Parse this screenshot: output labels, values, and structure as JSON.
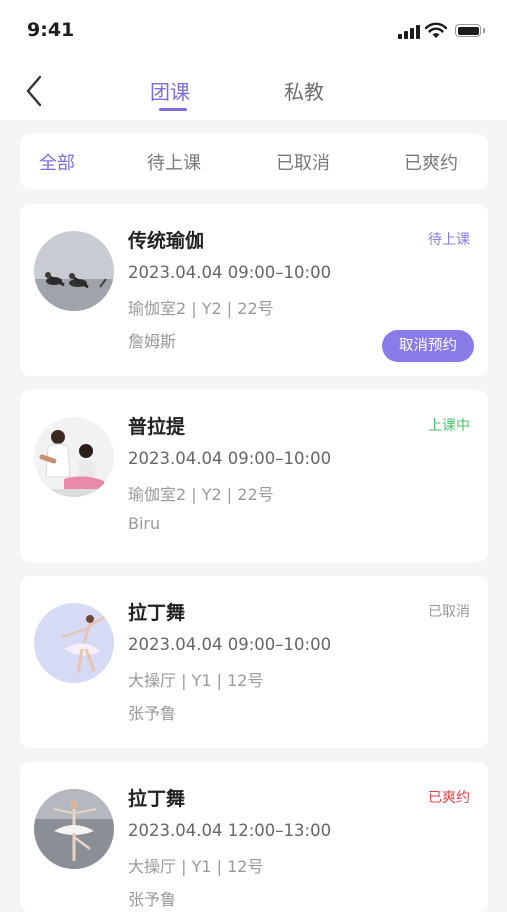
{
  "status_bar": {
    "time": "9:41"
  },
  "header": {
    "back_icon": "chevron-left-icon",
    "tabs": [
      {
        "label": "团课",
        "active": true
      },
      {
        "label": "私教",
        "active": false
      }
    ]
  },
  "filters": [
    {
      "label": "全部",
      "active": true
    },
    {
      "label": "待上课",
      "active": false
    },
    {
      "label": "已取消",
      "active": false
    },
    {
      "label": "已爽约",
      "active": false
    }
  ],
  "colors": {
    "accent": "#7a6fe0",
    "status_pending": "#8a7ce8",
    "status_in_class": "#4cc46e",
    "status_cancelled": "#999999",
    "status_no_show": "#e84040"
  },
  "bookings": [
    {
      "title": "传统瑜伽",
      "datetime": "2023.04.04   09:00–10:00",
      "room": "瑜伽室2 | Y2 | 22号",
      "coach": "詹姆斯",
      "status": "待上课",
      "action": "取消预约"
    },
    {
      "title": "普拉提",
      "datetime": "2023.04.04   09:00–10:00",
      "room": "瑜伽室2 | Y2 | 22号",
      "coach": "Biru",
      "status": "上课中"
    },
    {
      "title": "拉丁舞",
      "datetime": "2023.04.04   09:00–10:00",
      "room": "大操厅 | Y1 | 12号",
      "coach": "张予鲁",
      "status": "已取消"
    },
    {
      "title": "拉丁舞",
      "datetime": "2023.04.04 12:00–13:00",
      "room": "大操厅 | Y1 | 12号",
      "coach": "张予鲁",
      "status": "已爽约"
    }
  ]
}
